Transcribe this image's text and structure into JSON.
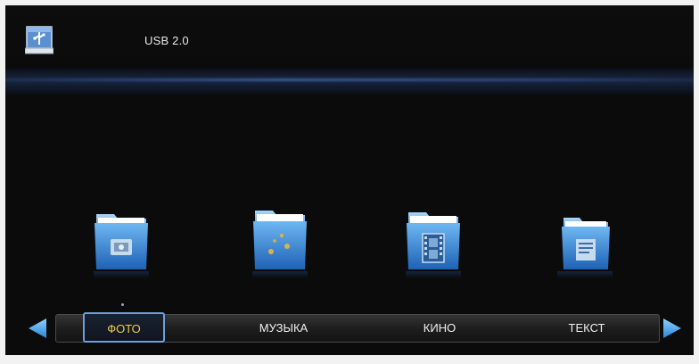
{
  "header": {
    "device_label": "USB 2.0",
    "device_icon": "usb-drive-icon"
  },
  "folders": [
    {
      "icon": "photo-folder-icon"
    },
    {
      "icon": "music-folder-icon"
    },
    {
      "icon": "movie-folder-icon"
    },
    {
      "icon": "text-folder-icon"
    }
  ],
  "categories": {
    "photo": "ФОТО",
    "music": "МУЗЫКА",
    "movie": "КИНО",
    "text": "ТЕКСТ",
    "selected": "photo"
  },
  "nav": {
    "left_icon": "arrow-left-icon",
    "right_icon": "arrow-right-icon"
  },
  "colors": {
    "background": "#0b0b0b",
    "accent_blue": "#3f8fd8",
    "selected_text": "#f2c94c",
    "selected_border": "#6f9fd6"
  }
}
